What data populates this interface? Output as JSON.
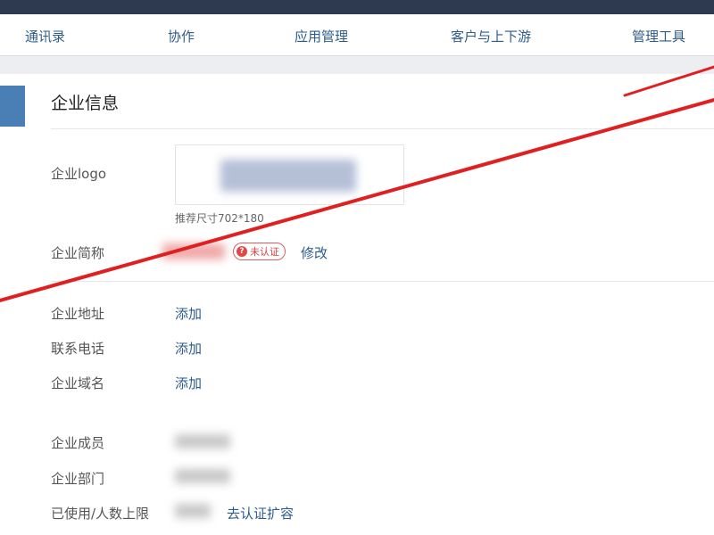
{
  "nav": {
    "items": [
      "通讯录",
      "协作",
      "应用管理",
      "客户与上下游",
      "管理工具"
    ]
  },
  "card": {
    "title": "企业信息",
    "logo_label": "企业logo",
    "logo_hint": "推荐尺寸702*180",
    "short_name_label": "企业简称",
    "verify_badge": "未认证",
    "verify_icon": "?",
    "modify_link": "修改",
    "address_label": "企业地址",
    "address_action": "添加",
    "phone_label": "联系电话",
    "phone_action": "添加",
    "domain_label": "企业域名",
    "domain_action": "添加",
    "members_label": "企业成员",
    "departments_label": "企业部门",
    "usage_label": "已使用/人数上限",
    "expand_link": "去认证扩容"
  },
  "colors": {
    "accent": "#2d5c8a",
    "topbar": "#2e3a4f",
    "warning": "#d84040",
    "annotation": "#e02020"
  }
}
